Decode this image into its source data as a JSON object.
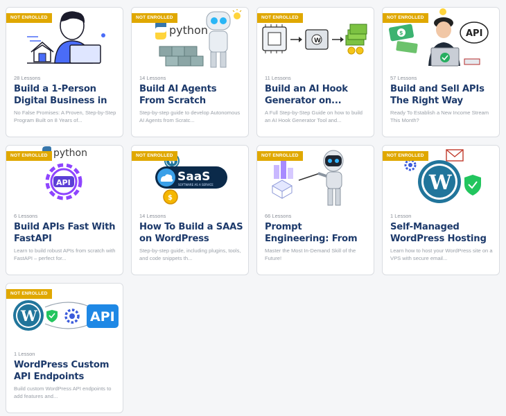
{
  "badge_label": "NOT ENROLLED",
  "colors": {
    "badge": "#e0a800",
    "title": "#1d3a6b",
    "wordpress": "#21759b"
  },
  "courses": [
    {
      "lessons": "28 Lessons",
      "title": "Build a 1-Person Digital Business in 6...",
      "description": "No False Promises: A Proven, Step-by-Step Program Built on 8 Years of...",
      "thumb_icon": "person-laptop-illustration"
    },
    {
      "lessons": "14 Lessons",
      "title": "Build AI Agents From Scratch",
      "description": "Step-by-step guide to develop Autonomous AI Agents from Scratc...",
      "thumb_icon": "python-robot-illustration",
      "thumb_text": "python"
    },
    {
      "lessons": "11 Lessons",
      "title": "Build an AI Hook Generator on...",
      "description": "A Full Step-by-Step Guide on how to build an AI Hook Generator Tool and...",
      "thumb_icon": "chip-engine-money-illustration"
    },
    {
      "lessons": "57 Lessons",
      "title": "Build and Sell APIs The Right Way",
      "description": "Ready To Establish a New Income Stream This Month?",
      "thumb_icon": "api-seller-illustration",
      "thumb_text": "API"
    },
    {
      "lessons": "6 Lessons",
      "title": "Build APIs Fast With FastAPI",
      "description": "Learn to build robust APIs from scratch with FastAPI – perfect for...",
      "thumb_icon": "python-api-gear-illustration",
      "thumb_text": "python",
      "thumb_text2": "API"
    },
    {
      "lessons": "14 Lessons",
      "title": "How To Build a SAAS on WordPress",
      "description": "Step-by-step guide, including plugins, tools, and code snippets th...",
      "thumb_icon": "saas-wordpress-illustration",
      "thumb_text": "SaaS",
      "thumb_text2": "SOFTWARE AS A SERVICE"
    },
    {
      "lessons": "66 Lessons",
      "title": "Prompt Engineering: From Zero To...",
      "description": "Master the Most In-Demand Skill of the Future!",
      "thumb_icon": "robot-presenting-illustration"
    },
    {
      "lessons": "1 Lesson",
      "title": "Self-Managed WordPress Hosting",
      "description": "Learn how to host your WordPress site on a VPS with secure email...",
      "thumb_icon": "wordpress-shield-illustration"
    },
    {
      "lessons": "1 Lesson",
      "title": "WordPress Custom API Endpoints",
      "description": "Build custom WordPress API endpoints to add features and...",
      "thumb_icon": "wordpress-api-illustration",
      "thumb_text": "API"
    }
  ]
}
